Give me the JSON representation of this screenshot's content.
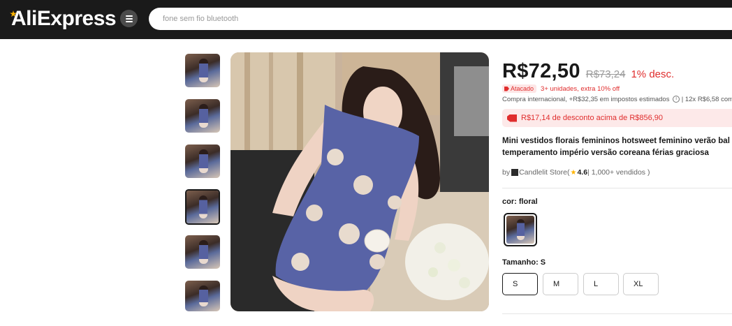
{
  "header": {
    "logo": "AliExpress",
    "search_placeholder": "fone sem fio bluetooth"
  },
  "gallery": {
    "thumbnails": [
      "thumb-1",
      "thumb-2",
      "thumb-3",
      "thumb-4",
      "thumb-5",
      "thumb-6"
    ],
    "selected_index": 4
  },
  "product": {
    "price": "R$72,50",
    "old_price": "R$73,24",
    "discount": "1% desc.",
    "wholesale_badge": "Atacado",
    "wholesale_text": "3+ unidades, extra 10% off",
    "tax_text": "Compra internacional, +R$32,35 em impostos estimados",
    "installments": "| 12x R$6,58 com",
    "coupon": "R$17,14 de desconto acima de R$856,90",
    "title_line1": "Mini vestidos florais femininos hotsweet feminino verão bal",
    "title_line2": "temperamento império versão coreana férias graciosa",
    "store_prefix": "by",
    "store_name": "Candlelit Store",
    "store_open": " (",
    "rating": "4.6",
    "sold": " | 1,000+ vendidos )",
    "color_label": "cor: floral",
    "size_label": "Tamanho: S",
    "sizes": [
      "S",
      "M",
      "L",
      "XL"
    ],
    "selected_size": "S"
  },
  "colors": {
    "accent": "#e02d2d",
    "header_bg": "#1a1a1a",
    "rating_star": "#ffb400"
  }
}
